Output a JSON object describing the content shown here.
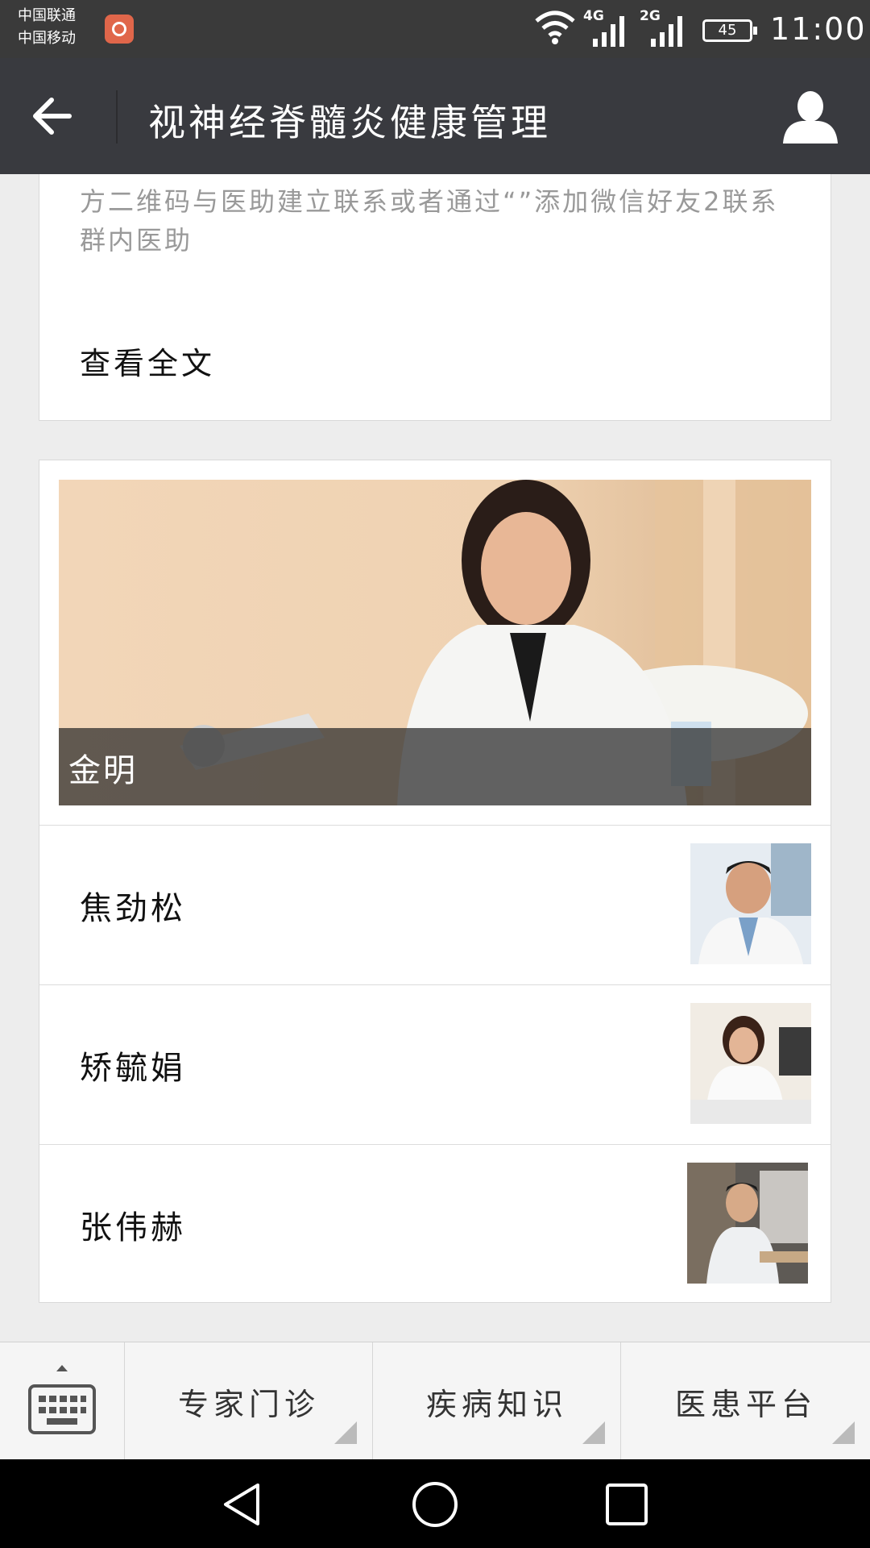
{
  "status_bar": {
    "carrier_1": "中国联通",
    "carrier_2": "中国移动",
    "net_1": "4G",
    "net_2": "2G",
    "battery": "45",
    "time": "11:00"
  },
  "header": {
    "title": "视神经脊髓炎健康管理",
    "back_icon": "arrow-left-icon",
    "user_icon": "user-icon"
  },
  "article": {
    "excerpt": "方二维码与医助建立联系或者通过“”添加微信好友2联系群内医助",
    "read_more": "查看全文"
  },
  "doctors": {
    "featured_name": "金明",
    "list": [
      {
        "name": "焦劲松"
      },
      {
        "name": "矫毓娟"
      },
      {
        "name": "张伟赫"
      }
    ]
  },
  "bottom_menu": {
    "items": [
      {
        "label": "专家门诊"
      },
      {
        "label": "疾病知识"
      },
      {
        "label": "医患平台"
      }
    ],
    "keyboard_icon": "keyboard-icon"
  },
  "colors": {
    "header_bg": "#393a3f",
    "status_bg": "#3a3a3a",
    "page_bg": "#ededed"
  }
}
